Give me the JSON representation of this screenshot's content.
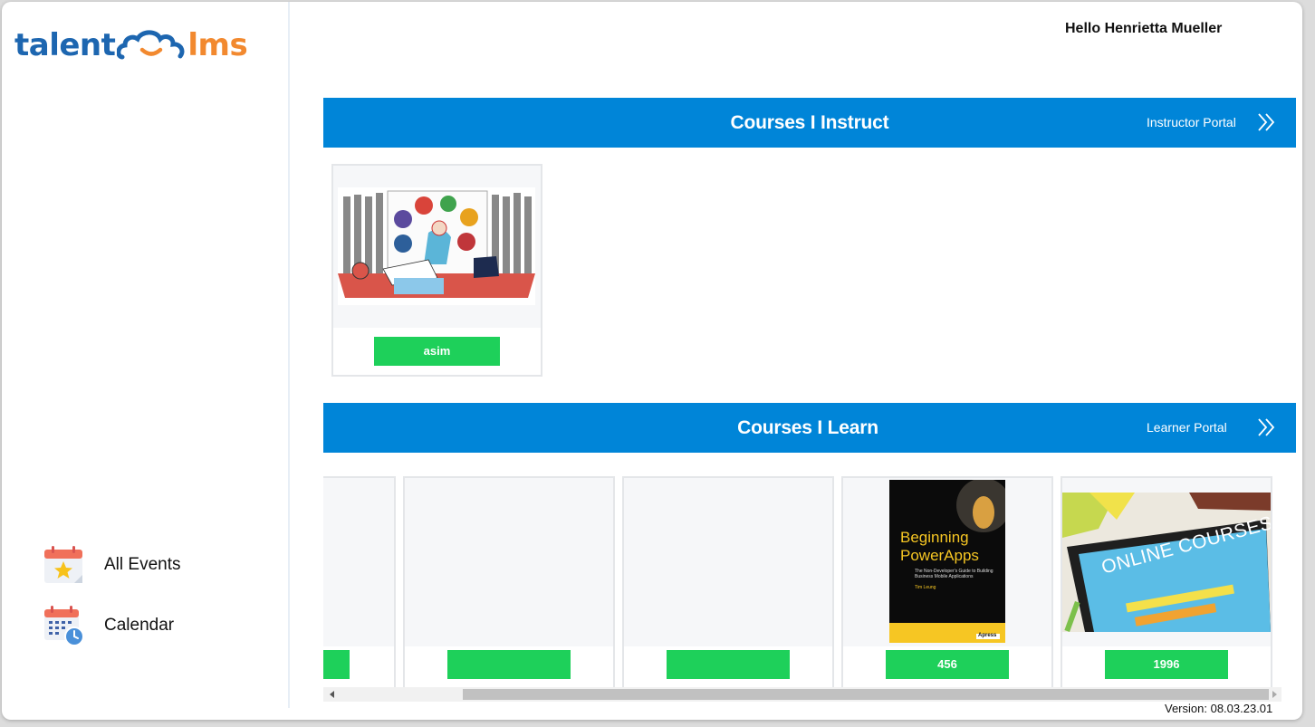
{
  "logo": {
    "part1": "talent",
    "part2": "lms"
  },
  "header": {
    "greeting": "Hello Henrietta Mueller"
  },
  "sidebar": {
    "links": [
      {
        "label": "All Events",
        "icon": "calendar-star-icon"
      },
      {
        "label": "Calendar",
        "icon": "calendar-clock-icon"
      }
    ]
  },
  "instruct": {
    "title": "Courses I Instruct",
    "portal_label": "Instructor Portal",
    "courses": [
      {
        "name": "asim",
        "image": "study-illustration"
      }
    ]
  },
  "learn": {
    "title": "Courses I Learn",
    "portal_label": "Learner Portal",
    "courses": [
      {
        "name": "",
        "image": ""
      },
      {
        "name": "",
        "image": ""
      },
      {
        "name": "",
        "image": ""
      },
      {
        "name": "456",
        "image": "book-cover",
        "book_title_line1": "Beginning",
        "book_title_line2": "PowerApps",
        "book_subtitle": "The Non-Developer's Guide to Building Business Mobile Applications",
        "book_author": "Tim Leung",
        "book_publisher": "Apress"
      },
      {
        "name": "1996",
        "image": "online-courses-tablet",
        "image_text": "ONLINE COURSES"
      }
    ]
  },
  "footer": {
    "version": "Version: 08.03.23.01"
  },
  "colors": {
    "section_bar": "#0085d8",
    "badge": "#1ed05a",
    "logo_blue": "#1d66b0",
    "logo_orange": "#f2892f"
  }
}
